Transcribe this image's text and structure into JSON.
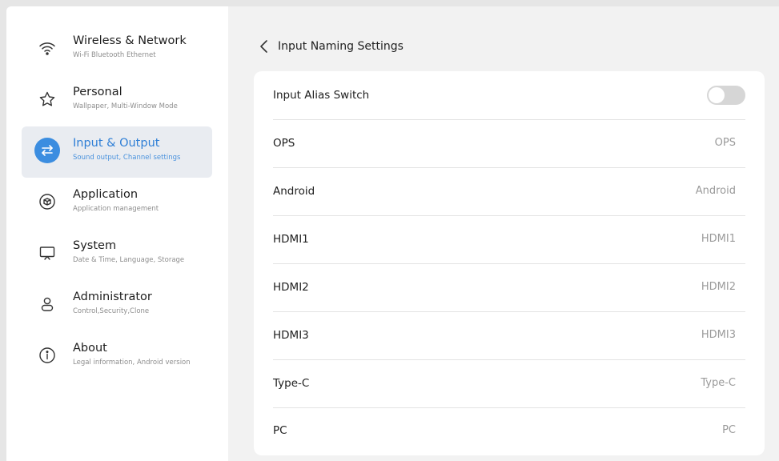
{
  "sidebar": {
    "items": [
      {
        "title": "Wireless & Network",
        "subtitle": "Wi-Fi Bluetooth Ethernet",
        "icon": "wifi-icon"
      },
      {
        "title": "Personal",
        "subtitle": "Wallpaper, Multi-Window Mode",
        "icon": "star-icon"
      },
      {
        "title": "Input & Output",
        "subtitle": "Sound output, Channel settings",
        "icon": "swap-arrows-icon",
        "active": true
      },
      {
        "title": "Application",
        "subtitle": "Application management",
        "icon": "box-icon"
      },
      {
        "title": "System",
        "subtitle": "Date & Time, Language, Storage",
        "icon": "monitor-icon"
      },
      {
        "title": "Administrator",
        "subtitle": "Control,Security,Clone",
        "icon": "user-icon"
      },
      {
        "title": "About",
        "subtitle": "Legal information, Android version",
        "icon": "info-icon"
      }
    ]
  },
  "header": {
    "title": "Input Naming Settings"
  },
  "settings": {
    "alias_switch": {
      "label": "Input Alias Switch",
      "enabled": false
    },
    "inputs": [
      {
        "label": "OPS",
        "value": "OPS"
      },
      {
        "label": "Android",
        "value": "Android"
      },
      {
        "label": "HDMI1",
        "value": "HDMI1"
      },
      {
        "label": "HDMI2",
        "value": "HDMI2"
      },
      {
        "label": "HDMI3",
        "value": "HDMI3"
      },
      {
        "label": "Type-C",
        "value": "Type-C"
      },
      {
        "label": "PC",
        "value": "PC"
      }
    ]
  },
  "colors": {
    "accent": "#3b8de0",
    "active_bg": "#e9ecf1",
    "toggle_off": "#d6d6d6"
  }
}
